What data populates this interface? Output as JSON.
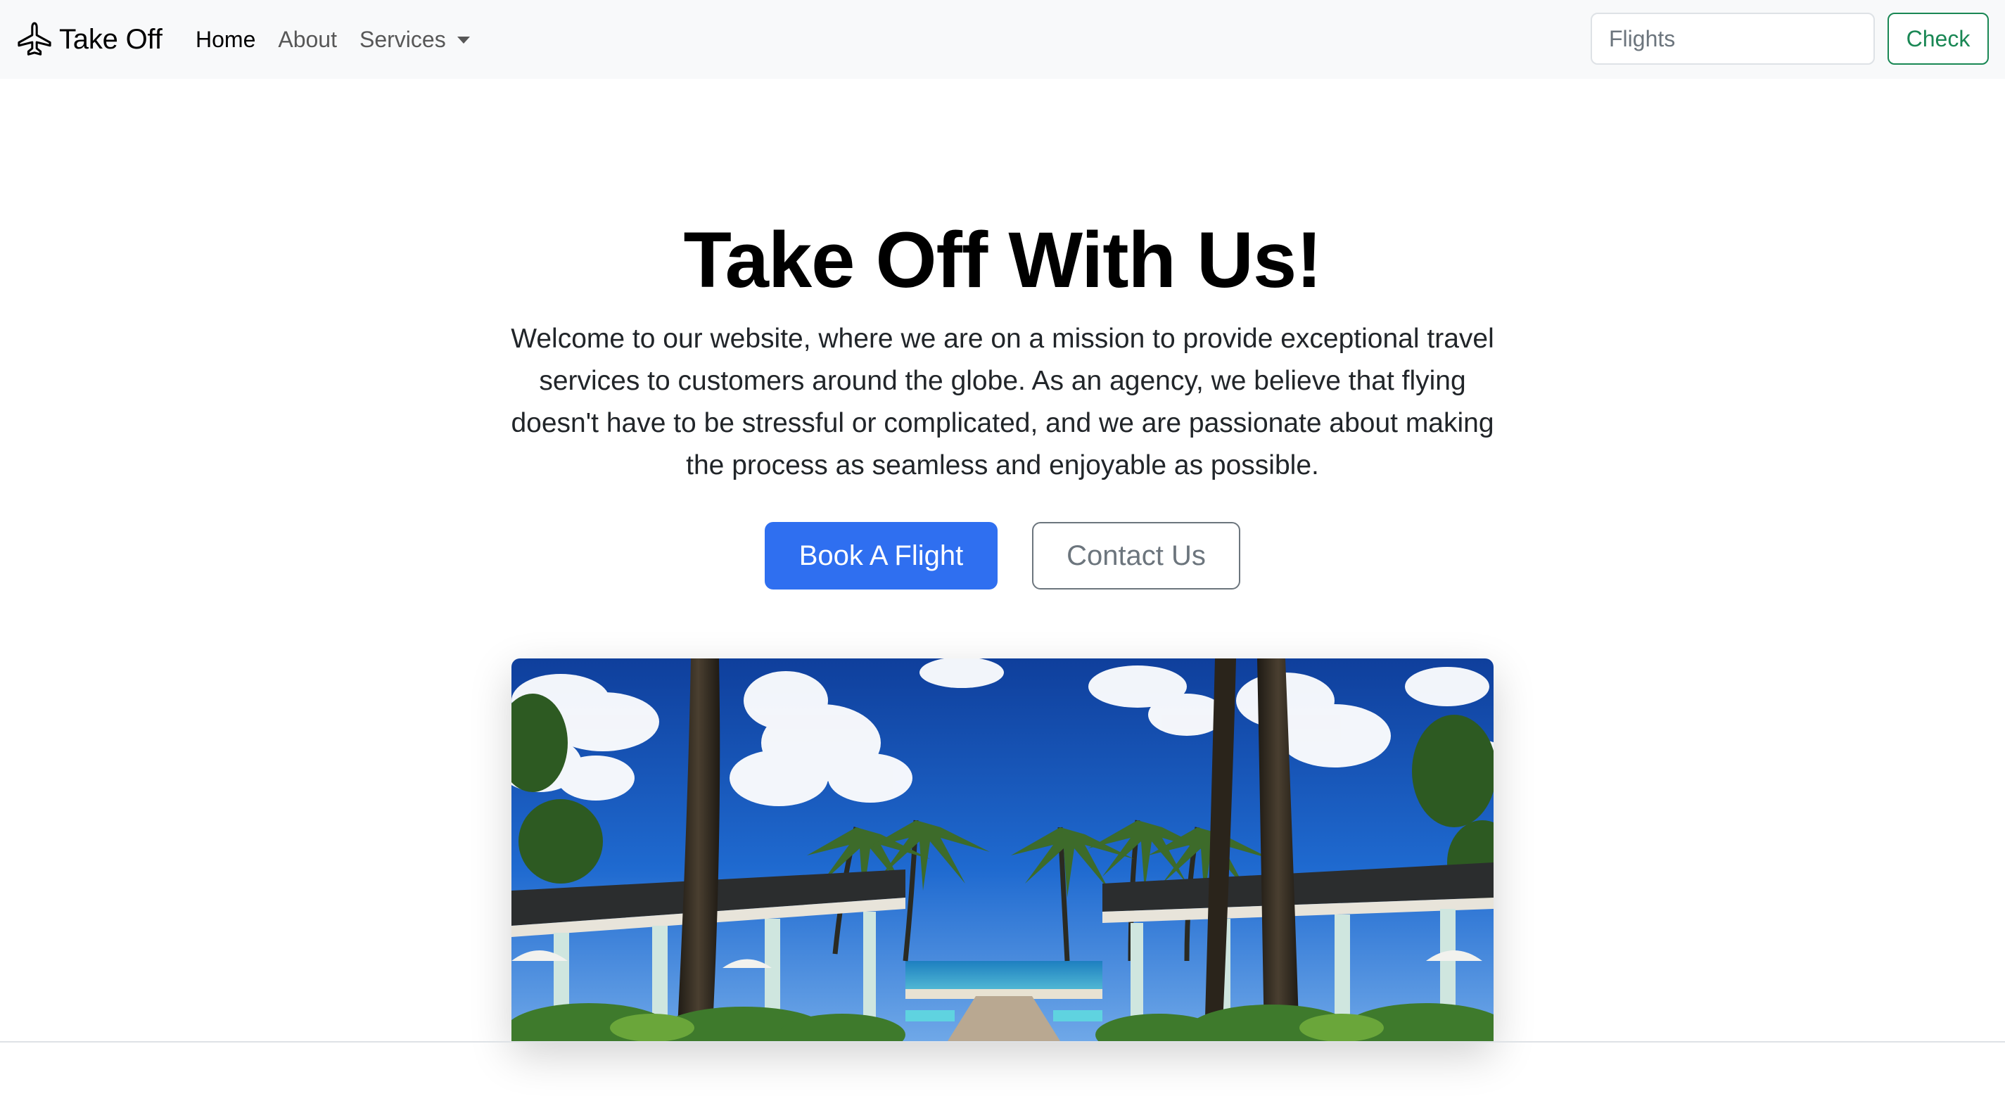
{
  "navbar": {
    "brand": "Take Off",
    "brand_icon": "airplane-icon",
    "links": [
      {
        "label": "Home",
        "active": true
      },
      {
        "label": "About",
        "active": false
      },
      {
        "label": "Services",
        "active": false,
        "dropdown": true
      }
    ],
    "search_value": "Flights",
    "check_label": "Check"
  },
  "hero": {
    "title": "Take Off With Us!",
    "lead": "Welcome to our website, where we are on a mission to provide exceptional travel services to customers around the globe. As an agency, we believe that flying doesn't have to be stressful or complicated, and we are passionate about making the process as seamless and enjoyable as possible.",
    "primary_button": "Book A Flight",
    "secondary_button": "Contact Us"
  },
  "colors": {
    "navbar_bg": "#f8f9fa",
    "primary": "#2f6ff0",
    "success": "#198754",
    "secondary": "#6c757d"
  }
}
